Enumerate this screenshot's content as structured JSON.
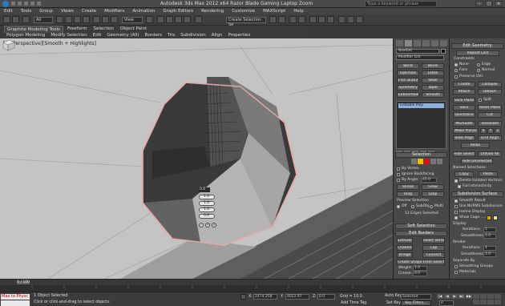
{
  "app": {
    "title": "Autodesk 3ds Max 2012 x64     Razor Blade Gaming Laptop Zoom",
    "search_placeholder": "Type a keyword or phrase"
  },
  "menu": [
    "Edit",
    "Tools",
    "Group",
    "Views",
    "Create",
    "Modifiers",
    "Animation",
    "Graph Editors",
    "Rendering",
    "Customize",
    "MAXScript",
    "Help"
  ],
  "toolbar": {
    "selection_filter": "All",
    "ref_coord": "View",
    "named_selection": "Create Selection Se"
  },
  "ribbon": {
    "tabs": [
      "Graphite Modeling Tools",
      "Freeform",
      "Selection",
      "Object Paint"
    ],
    "subtabs": [
      "Polygon Modeling",
      "Modify Selection",
      "Edit",
      "Geometry (All)",
      "Borders",
      "Tris",
      "Subdivision",
      "Align",
      "Properties"
    ]
  },
  "viewport": {
    "label": "[+][Perspective][Smooth + Highlights]"
  },
  "caddy": {
    "header": "0.0",
    "values": [
      "1.0",
      "1.0",
      "1.0",
      "0.0"
    ]
  },
  "command_panel": {
    "object_name": "Box006",
    "modifier_list": "Modifier List",
    "buttons": [
      [
        "Bend",
        "Bevel"
      ],
      [
        "Optimize",
        "Lathe"
      ],
      [
        "FFD 3x3x3",
        "Shell"
      ],
      [
        "Symmetry",
        "Taper"
      ],
      [
        "TurboSmooth",
        "Smooth"
      ]
    ],
    "stack_item": "Editable Poly",
    "selection": {
      "title": "Selection",
      "by_vertex": "By Vertex",
      "ignore_backfacing": "Ignore Backfacing",
      "by_angle": "By Angle:",
      "by_angle_value": "45.0",
      "shrink": "Shrink",
      "grow": "Grow",
      "ring": "Ring",
      "loop": "Loop",
      "preview_selection": "Preview Selection",
      "off": "Off",
      "subobj": "SubObj",
      "multi": "Multi",
      "status": "12 Edges Selected"
    },
    "soft_selection": "Soft Selection",
    "edit_borders": {
      "title": "Edit Borders",
      "extrude": "Extrude",
      "insert_vertex": "Insert Vertex",
      "chamfer": "Chamfer",
      "cap": "Cap",
      "bridge": "Bridge",
      "connect": "Connect",
      "create_shape": "Create Shape From Selection",
      "weight": "Weight:",
      "weight_value": "1.0",
      "crease": "Crease:",
      "crease_value": "0.0",
      "edit_tri": "Edit Tri.",
      "turn": "Turn"
    }
  },
  "right_panel": {
    "edit_geometry": "Edit Geometry",
    "repeat_last": "Repeat Last",
    "constraints": "Constraints",
    "none": "None",
    "edge": "Edge",
    "face": "Face",
    "normal": "Normal",
    "preserve_uvs": "Preserve UVs",
    "create": "Create",
    "collapse": "Collapse",
    "attach": "Attach",
    "detach": "Detach",
    "slice_plane": "Slice Plane",
    "split": "Split",
    "slice": "Slice",
    "reset_plane": "Reset Plane",
    "quickslice": "QuickSlice",
    "cut": "Cut",
    "msmooth": "MSmooth",
    "tessellate": "Tessellate",
    "make_planar": "Make Planar",
    "x": "X",
    "y": "Y",
    "z": "Z",
    "view_align": "View Align",
    "grid_align": "Grid Align",
    "relax": "Relax",
    "hide_selected": "Hide Selected",
    "unhide_all": "Unhide All",
    "hide_unselected": "Hide Unselected",
    "named_selections": "Named Selections:",
    "copy": "Copy",
    "paste": "Paste",
    "delete_isolated": "Delete Isolated Vertices",
    "full_interactivity": "Full Interactivity",
    "subdivision_surface": "Subdivision Surface",
    "smooth_result": "Smooth Result",
    "use_nurms": "Use NURMS Subdivision",
    "isoline_display": "Isoline Display",
    "show_cage": "Show Cage......",
    "display": "Display",
    "iterations": "Iterations:",
    "iterations_value": "1",
    "smoothness": "Smoothness:",
    "smoothness_value": "1.0",
    "render": "Render",
    "separate_by": "Separate By",
    "smoothing_groups": "Smoothing Groups",
    "materials": "Materials",
    "update_options": "Update Options",
    "always": "Always",
    "when_rendering": "When Rendering",
    "manually": "Manually"
  },
  "timeslider": {
    "frame": "0 / 100"
  },
  "status": {
    "maxscript_label": "Max to Physc",
    "objects_selected": "1 Object Selected",
    "prompt": "Click or click-and-drag to select objects",
    "x_label": "X:",
    "x_value": "2474.258",
    "y_label": "Y:",
    "y_value": "4022.97",
    "z_label": "Z:",
    "z_value": "0.0",
    "grid": "Grid = 10.0",
    "add_time_tag": "Add Time Tag",
    "auto_key": "Auto Key",
    "selected": "Selected",
    "set_key": "Set Key",
    "key_filters": "Key Filters...",
    "current_frame": "0"
  }
}
